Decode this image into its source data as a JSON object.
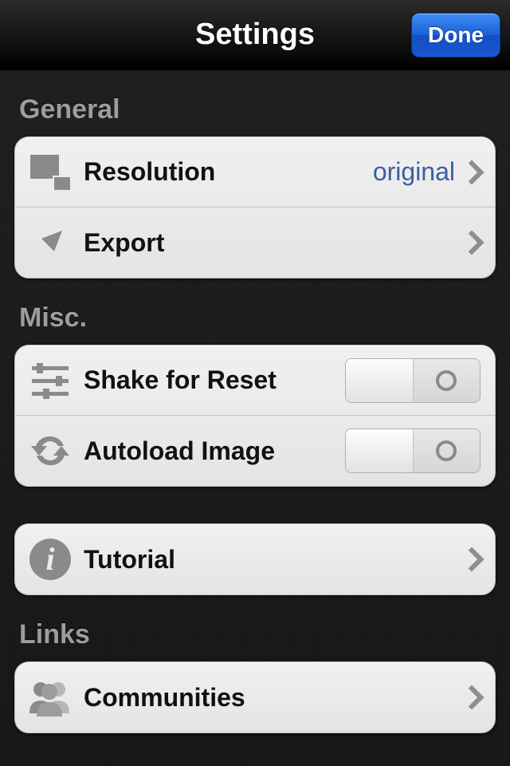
{
  "navbar": {
    "title": "Settings",
    "done_label": "Done"
  },
  "sections": {
    "general": {
      "header": "General",
      "resolution": {
        "label": "Resolution",
        "value": "original"
      },
      "export": {
        "label": "Export"
      }
    },
    "misc": {
      "header": "Misc.",
      "shake": {
        "label": "Shake for Reset",
        "on": false
      },
      "autoload": {
        "label": "Autoload Image",
        "on": false
      }
    },
    "tutorial": {
      "label": "Tutorial"
    },
    "links": {
      "header": "Links",
      "communities": {
        "label": "Communities"
      }
    }
  }
}
